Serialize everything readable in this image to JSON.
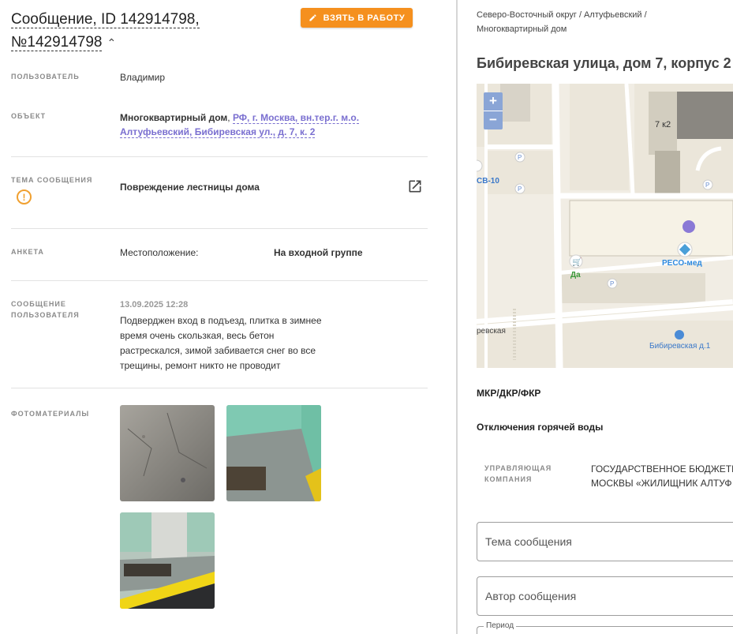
{
  "message": {
    "title_line1": "Сообщение, ID 142914798,",
    "title_line2": "№142914798",
    "take_button": "ВЗЯТЬ В РАБОТУ"
  },
  "fields": {
    "user_label": "ПОЛЬЗОВАТЕЛЬ",
    "user_value": "Владимир",
    "object_label": "ОБЪЕКТ",
    "object_type": "Многоквартирный дом",
    "object_link_line1": "РФ, г. Москва, вн.тер.г. м.о.",
    "object_link_line2": "Алтуфьевский, Бибиревская ул., д. 7, к. 2",
    "topic_label": "ТЕМА СООБЩЕНИЯ",
    "topic_value": "Повреждение лестницы дома",
    "survey_label": "АНКЕТА",
    "survey_key": "Местоположение:",
    "survey_value": "На входной группе",
    "message_label_line1": "СООБЩЕНИЕ",
    "message_label_line2": "ПОЛЬЗОВАТЕЛЯ",
    "message_date": "13.09.2025 12:28",
    "message_text_lines": [
      "Подверджен вход в подъезд, плитка в зимнее",
      "время очень скользкая, весь бетон",
      "растрескался, зимой забивается снег во все",
      "трещины, ремонт никто не проводит"
    ],
    "photos_label": "ФОТОМАТЕРИАЛЫ"
  },
  "right": {
    "breadcrumb_line1": "Северо-Восточный округ / Алтуфьевский /",
    "breadcrumb_line2": "Многоквартирный дом",
    "address": "Бибиревская улица, дом 7, корпус 2",
    "map": {
      "zoom_in": "+",
      "zoom_out": "−",
      "building_label": "7 к2",
      "stop_label": "СВ-10",
      "poi_label": "РЕСО-мед",
      "shop_label": "Да",
      "street_label": "ревская",
      "bus_label": "Бибиревская д.1",
      "parking": "P"
    },
    "section1": "МКР/ДКР/ФКР",
    "section2": "Отключения горячей воды",
    "mgmt_label_line1": "УПРАВЛЯЮЩАЯ",
    "mgmt_label_line2": "КОМПАНИЯ",
    "mgmt_value_line1": "ГОСУДАРСТВЕННОЕ БЮДЖЕТН",
    "mgmt_value_line2": "МОСКВЫ «ЖИЛИЩНИК АЛТУФ",
    "topic_placeholder": "Тема сообщения",
    "author_placeholder": "Автор сообщения",
    "period_label": "Период"
  },
  "colors": {
    "accent": "#f5901e",
    "link": "#7a6fd0",
    "map_bg": "#f1ede4"
  }
}
